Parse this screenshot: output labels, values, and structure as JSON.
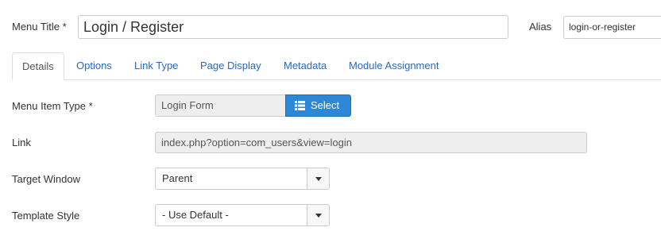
{
  "header": {
    "menu_title_label": "Menu Title *",
    "menu_title_value": "Login / Register",
    "alias_label": "Alias",
    "alias_value": "login-or-register"
  },
  "tabs": [
    {
      "label": "Details",
      "active": true
    },
    {
      "label": "Options",
      "active": false
    },
    {
      "label": "Link Type",
      "active": false
    },
    {
      "label": "Page Display",
      "active": false
    },
    {
      "label": "Metadata",
      "active": false
    },
    {
      "label": "Module Assignment",
      "active": false
    }
  ],
  "form": {
    "menu_item_type": {
      "label": "Menu Item Type *",
      "value": "Login Form",
      "button_label": "Select",
      "button_icon": "list-icon"
    },
    "link": {
      "label": "Link",
      "value": "index.php?option=com_users&view=login"
    },
    "target_window": {
      "label": "Target Window",
      "value": "Parent",
      "icon": "caret-down-icon"
    },
    "template_style": {
      "label": "Template Style",
      "value": "- Use Default -",
      "icon": "caret-down-icon"
    }
  },
  "colors": {
    "accent_button": "#2d87d8",
    "tab_link": "#2a69b8",
    "readonly_bg": "#eeeeee"
  }
}
